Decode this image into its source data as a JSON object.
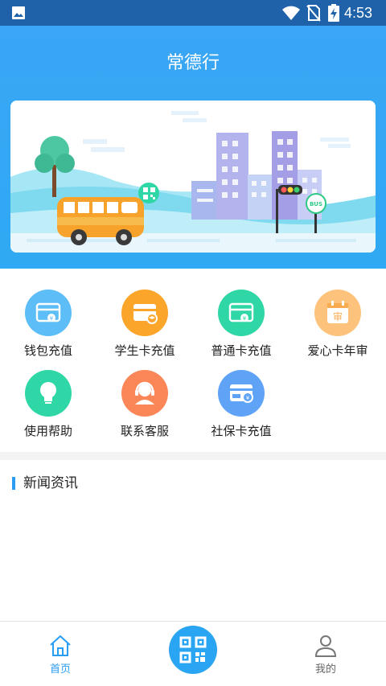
{
  "status_bar": {
    "time": "4:53"
  },
  "header": {
    "title": "常德行"
  },
  "banner": {
    "bus_sign": "BUS"
  },
  "menu": {
    "items": [
      {
        "label": "钱包充值",
        "icon": "wallet-card-icon",
        "color": "#5cbdf7"
      },
      {
        "label": "学生卡充值",
        "icon": "student-card-icon",
        "color": "#fba52a"
      },
      {
        "label": "普通卡充值",
        "icon": "regular-card-icon",
        "color": "#2fd7a6"
      },
      {
        "label": "爱心卡年审",
        "icon": "annual-review-icon",
        "color": "#fdc37c"
      },
      {
        "label": "使用帮助",
        "icon": "lightbulb-icon",
        "color": "#2fd7a6"
      },
      {
        "label": "联系客服",
        "icon": "customer-service-icon",
        "color": "#fb8758"
      },
      {
        "label": "社保卡充值",
        "icon": "social-security-card-icon",
        "color": "#5fa3f7"
      }
    ],
    "review_char": "审"
  },
  "news": {
    "title": "新闻资讯"
  },
  "tabbar": {
    "home_label": "首页",
    "mine_label": "我的",
    "accent": "#2a9df4"
  }
}
